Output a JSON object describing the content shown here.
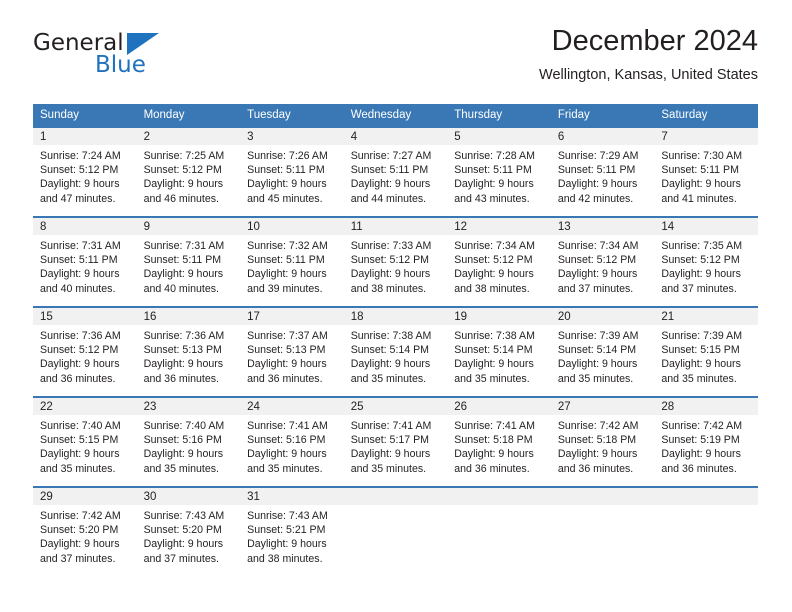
{
  "brand": {
    "name_top": "General",
    "name_bottom": "Blue",
    "triangle_icon": "triangle-icon",
    "color_primary": "#1f72bd",
    "color_text": "#231f20"
  },
  "header": {
    "title": "December 2024",
    "subtitle": "Wellington, Kansas, United States"
  },
  "calendar": {
    "accent_color": "#3a78b5",
    "daynum_band_color": "#f1f1f1",
    "weekday_headers": [
      "Sunday",
      "Monday",
      "Tuesday",
      "Wednesday",
      "Thursday",
      "Friday",
      "Saturday"
    ],
    "weeks": [
      [
        {
          "day": "1",
          "sunrise": "Sunrise: 7:24 AM",
          "sunset": "Sunset: 5:12 PM",
          "daylight_line1": "Daylight: 9 hours",
          "daylight_line2": "and 47 minutes."
        },
        {
          "day": "2",
          "sunrise": "Sunrise: 7:25 AM",
          "sunset": "Sunset: 5:12 PM",
          "daylight_line1": "Daylight: 9 hours",
          "daylight_line2": "and 46 minutes."
        },
        {
          "day": "3",
          "sunrise": "Sunrise: 7:26 AM",
          "sunset": "Sunset: 5:11 PM",
          "daylight_line1": "Daylight: 9 hours",
          "daylight_line2": "and 45 minutes."
        },
        {
          "day": "4",
          "sunrise": "Sunrise: 7:27 AM",
          "sunset": "Sunset: 5:11 PM",
          "daylight_line1": "Daylight: 9 hours",
          "daylight_line2": "and 44 minutes."
        },
        {
          "day": "5",
          "sunrise": "Sunrise: 7:28 AM",
          "sunset": "Sunset: 5:11 PM",
          "daylight_line1": "Daylight: 9 hours",
          "daylight_line2": "and 43 minutes."
        },
        {
          "day": "6",
          "sunrise": "Sunrise: 7:29 AM",
          "sunset": "Sunset: 5:11 PM",
          "daylight_line1": "Daylight: 9 hours",
          "daylight_line2": "and 42 minutes."
        },
        {
          "day": "7",
          "sunrise": "Sunrise: 7:30 AM",
          "sunset": "Sunset: 5:11 PM",
          "daylight_line1": "Daylight: 9 hours",
          "daylight_line2": "and 41 minutes."
        }
      ],
      [
        {
          "day": "8",
          "sunrise": "Sunrise: 7:31 AM",
          "sunset": "Sunset: 5:11 PM",
          "daylight_line1": "Daylight: 9 hours",
          "daylight_line2": "and 40 minutes."
        },
        {
          "day": "9",
          "sunrise": "Sunrise: 7:31 AM",
          "sunset": "Sunset: 5:11 PM",
          "daylight_line1": "Daylight: 9 hours",
          "daylight_line2": "and 40 minutes."
        },
        {
          "day": "10",
          "sunrise": "Sunrise: 7:32 AM",
          "sunset": "Sunset: 5:11 PM",
          "daylight_line1": "Daylight: 9 hours",
          "daylight_line2": "and 39 minutes."
        },
        {
          "day": "11",
          "sunrise": "Sunrise: 7:33 AM",
          "sunset": "Sunset: 5:12 PM",
          "daylight_line1": "Daylight: 9 hours",
          "daylight_line2": "and 38 minutes."
        },
        {
          "day": "12",
          "sunrise": "Sunrise: 7:34 AM",
          "sunset": "Sunset: 5:12 PM",
          "daylight_line1": "Daylight: 9 hours",
          "daylight_line2": "and 38 minutes."
        },
        {
          "day": "13",
          "sunrise": "Sunrise: 7:34 AM",
          "sunset": "Sunset: 5:12 PM",
          "daylight_line1": "Daylight: 9 hours",
          "daylight_line2": "and 37 minutes."
        },
        {
          "day": "14",
          "sunrise": "Sunrise: 7:35 AM",
          "sunset": "Sunset: 5:12 PM",
          "daylight_line1": "Daylight: 9 hours",
          "daylight_line2": "and 37 minutes."
        }
      ],
      [
        {
          "day": "15",
          "sunrise": "Sunrise: 7:36 AM",
          "sunset": "Sunset: 5:12 PM",
          "daylight_line1": "Daylight: 9 hours",
          "daylight_line2": "and 36 minutes."
        },
        {
          "day": "16",
          "sunrise": "Sunrise: 7:36 AM",
          "sunset": "Sunset: 5:13 PM",
          "daylight_line1": "Daylight: 9 hours",
          "daylight_line2": "and 36 minutes."
        },
        {
          "day": "17",
          "sunrise": "Sunrise: 7:37 AM",
          "sunset": "Sunset: 5:13 PM",
          "daylight_line1": "Daylight: 9 hours",
          "daylight_line2": "and 36 minutes."
        },
        {
          "day": "18",
          "sunrise": "Sunrise: 7:38 AM",
          "sunset": "Sunset: 5:14 PM",
          "daylight_line1": "Daylight: 9 hours",
          "daylight_line2": "and 35 minutes."
        },
        {
          "day": "19",
          "sunrise": "Sunrise: 7:38 AM",
          "sunset": "Sunset: 5:14 PM",
          "daylight_line1": "Daylight: 9 hours",
          "daylight_line2": "and 35 minutes."
        },
        {
          "day": "20",
          "sunrise": "Sunrise: 7:39 AM",
          "sunset": "Sunset: 5:14 PM",
          "daylight_line1": "Daylight: 9 hours",
          "daylight_line2": "and 35 minutes."
        },
        {
          "day": "21",
          "sunrise": "Sunrise: 7:39 AM",
          "sunset": "Sunset: 5:15 PM",
          "daylight_line1": "Daylight: 9 hours",
          "daylight_line2": "and 35 minutes."
        }
      ],
      [
        {
          "day": "22",
          "sunrise": "Sunrise: 7:40 AM",
          "sunset": "Sunset: 5:15 PM",
          "daylight_line1": "Daylight: 9 hours",
          "daylight_line2": "and 35 minutes."
        },
        {
          "day": "23",
          "sunrise": "Sunrise: 7:40 AM",
          "sunset": "Sunset: 5:16 PM",
          "daylight_line1": "Daylight: 9 hours",
          "daylight_line2": "and 35 minutes."
        },
        {
          "day": "24",
          "sunrise": "Sunrise: 7:41 AM",
          "sunset": "Sunset: 5:16 PM",
          "daylight_line1": "Daylight: 9 hours",
          "daylight_line2": "and 35 minutes."
        },
        {
          "day": "25",
          "sunrise": "Sunrise: 7:41 AM",
          "sunset": "Sunset: 5:17 PM",
          "daylight_line1": "Daylight: 9 hours",
          "daylight_line2": "and 35 minutes."
        },
        {
          "day": "26",
          "sunrise": "Sunrise: 7:41 AM",
          "sunset": "Sunset: 5:18 PM",
          "daylight_line1": "Daylight: 9 hours",
          "daylight_line2": "and 36 minutes."
        },
        {
          "day": "27",
          "sunrise": "Sunrise: 7:42 AM",
          "sunset": "Sunset: 5:18 PM",
          "daylight_line1": "Daylight: 9 hours",
          "daylight_line2": "and 36 minutes."
        },
        {
          "day": "28",
          "sunrise": "Sunrise: 7:42 AM",
          "sunset": "Sunset: 5:19 PM",
          "daylight_line1": "Daylight: 9 hours",
          "daylight_line2": "and 36 minutes."
        }
      ],
      [
        {
          "day": "29",
          "sunrise": "Sunrise: 7:42 AM",
          "sunset": "Sunset: 5:20 PM",
          "daylight_line1": "Daylight: 9 hours",
          "daylight_line2": "and 37 minutes."
        },
        {
          "day": "30",
          "sunrise": "Sunrise: 7:43 AM",
          "sunset": "Sunset: 5:20 PM",
          "daylight_line1": "Daylight: 9 hours",
          "daylight_line2": "and 37 minutes."
        },
        {
          "day": "31",
          "sunrise": "Sunrise: 7:43 AM",
          "sunset": "Sunset: 5:21 PM",
          "daylight_line1": "Daylight: 9 hours",
          "daylight_line2": "and 38 minutes."
        },
        {
          "day": "",
          "sunrise": "",
          "sunset": "",
          "daylight_line1": "",
          "daylight_line2": ""
        },
        {
          "day": "",
          "sunrise": "",
          "sunset": "",
          "daylight_line1": "",
          "daylight_line2": ""
        },
        {
          "day": "",
          "sunrise": "",
          "sunset": "",
          "daylight_line1": "",
          "daylight_line2": ""
        },
        {
          "day": "",
          "sunrise": "",
          "sunset": "",
          "daylight_line1": "",
          "daylight_line2": ""
        }
      ]
    ]
  }
}
